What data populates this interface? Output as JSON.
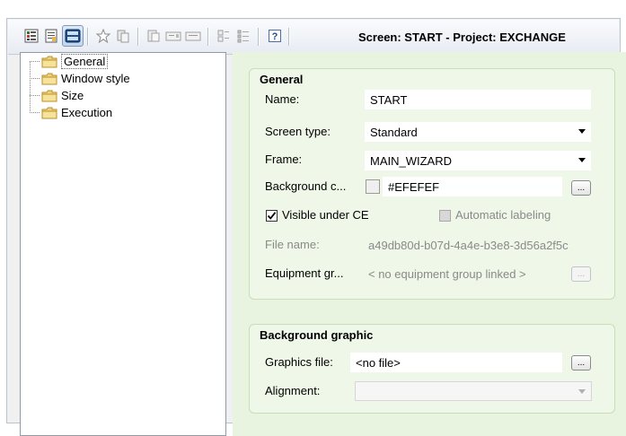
{
  "toolbar": {
    "title": "Screen: START - Project: EXCHANGE",
    "icons": [
      "object-list-icon",
      "properties-icon",
      "screen-view-icon",
      "favorite-star-icon",
      "copy-icon",
      "paste-icon",
      "input-field-icon",
      "output-field-icon",
      "align-icon",
      "list-view-icon",
      "help-icon"
    ]
  },
  "tree": {
    "items": [
      {
        "label": "General",
        "selected": true
      },
      {
        "label": "Window style"
      },
      {
        "label": "Size"
      },
      {
        "label": "Execution"
      }
    ]
  },
  "general": {
    "title": "General",
    "name_label": "Name:",
    "name_value": "START",
    "screen_type_label": "Screen type:",
    "screen_type_value": "Standard",
    "frame_label": "Frame:",
    "frame_value": "MAIN_WIZARD",
    "background_label": "Background c...",
    "background_value": "#EFEFEF",
    "background_color": "#EFEFEF",
    "browse_label": "...",
    "visible_ce_label": "Visible under CE",
    "visible_ce_checked": true,
    "auto_label_label": "Automatic labeling",
    "auto_label_checked": false,
    "file_name_label": "File name:",
    "file_name_value": "a49db80d-b07d-4a4e-b3e8-3d56a2f5c",
    "equipment_label": "Equipment gr...",
    "equipment_value": "< no equipment group linked >"
  },
  "background_graphic": {
    "title": "Background graphic",
    "graphics_file_label": "Graphics file:",
    "graphics_file_value": "<no file>",
    "alignment_label": "Alignment:",
    "alignment_value": ""
  },
  "colors": {
    "panel_bg": "#e8f3e0",
    "group_border": "#c9ddb9",
    "muted_text": "#8a8a8a"
  }
}
